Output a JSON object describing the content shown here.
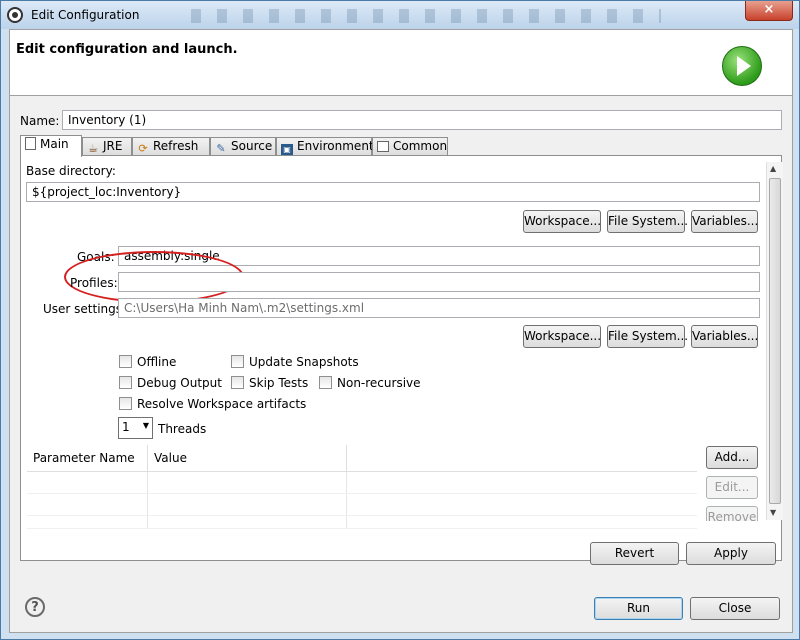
{
  "window": {
    "title": "Edit Configuration",
    "close_glyph": "×"
  },
  "banner": {
    "title": "Edit configuration and launch.",
    "icon": "run-launch-icon"
  },
  "name": {
    "label": "Name:",
    "value": "Inventory (1)"
  },
  "tabs": [
    {
      "label": "Main",
      "icon": "main-tab-icon"
    },
    {
      "label": "JRE",
      "icon": "jre-icon"
    },
    {
      "label": "Refresh",
      "icon": "refresh-icon"
    },
    {
      "label": "Source",
      "icon": "source-icon"
    },
    {
      "label": "Environment",
      "icon": "environment-icon"
    },
    {
      "label": "Common",
      "icon": "common-icon"
    }
  ],
  "main": {
    "base_dir_label": "Base directory:",
    "base_dir_value": "${project_loc:Inventory}",
    "workspace_btn": "Workspace...",
    "filesystem_btn": "File System...",
    "variables_btn": "Variables...",
    "goals_label": "Goals:",
    "goals_value": "assembly:single",
    "profiles_label": "Profiles:",
    "profiles_value": "",
    "user_settings_label": "User settings:",
    "user_settings_value": "C:\\Users\\Ha Minh Nam\\.m2\\settings.xml",
    "checkboxes": {
      "offline": "Offline",
      "update_snapshots": "Update Snapshots",
      "debug_output": "Debug Output",
      "skip_tests": "Skip Tests",
      "non_recursive": "Non-recursive",
      "resolve_workspace": "Resolve Workspace artifacts"
    },
    "threads_value": "1",
    "threads_label": "Threads",
    "params_table": {
      "columns": [
        "Parameter Name",
        "Value"
      ]
    },
    "add_btn": "Add...",
    "edit_btn": "Edit...",
    "remove_btn": "Remove"
  },
  "actions": {
    "revert": "Revert",
    "apply": "Apply",
    "run": "Run",
    "close": "Close"
  },
  "colors": {
    "annotation_circle": "#d62020",
    "title_bar": "#cfe0f1"
  }
}
